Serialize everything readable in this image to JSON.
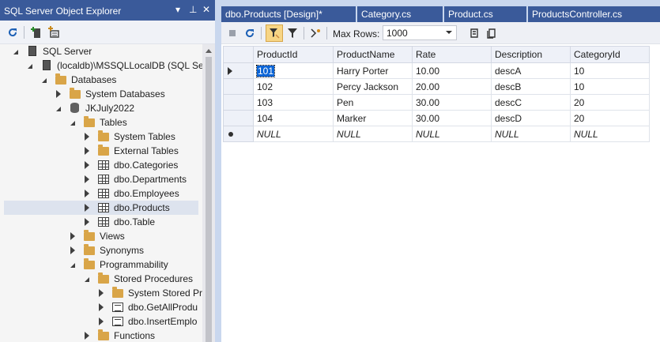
{
  "object_explorer": {
    "title": "SQL Server Object Explorer",
    "controls": {
      "dropdown": "▾",
      "pin": "⊥",
      "close": "✕"
    },
    "toolbar": {
      "refresh_icon": "refresh-icon",
      "add_server_icon": "add-server-icon",
      "filter_settings_icon": "filter-settings-icon"
    },
    "tree": [
      {
        "label": "SQL Server",
        "icon": "server-group-icon",
        "expanded": true
      },
      {
        "label": "(localdb)\\MSSQLLocalDB (SQL Se",
        "icon": "server-icon",
        "expanded": true
      },
      {
        "label": "Databases",
        "icon": "folder-icon",
        "expanded": true
      },
      {
        "label": "System Databases",
        "icon": "folder-icon",
        "expanded": false
      },
      {
        "label": "JKJuly2022",
        "icon": "database-icon",
        "expanded": true
      },
      {
        "label": "Tables",
        "icon": "folder-icon",
        "expanded": true
      },
      {
        "label": "System Tables",
        "icon": "folder-icon",
        "expanded": false
      },
      {
        "label": "External Tables",
        "icon": "folder-icon",
        "expanded": false
      },
      {
        "label": "dbo.Categories",
        "icon": "table-icon",
        "expanded": false
      },
      {
        "label": "dbo.Departments",
        "icon": "table-icon",
        "expanded": false
      },
      {
        "label": "dbo.Employees",
        "icon": "table-icon",
        "expanded": false
      },
      {
        "label": "dbo.Products",
        "icon": "table-icon",
        "expanded": false,
        "selected": true
      },
      {
        "label": "dbo.Table",
        "icon": "table-icon",
        "expanded": false
      },
      {
        "label": "Views",
        "icon": "folder-icon",
        "expanded": false
      },
      {
        "label": "Synonyms",
        "icon": "folder-icon",
        "expanded": false
      },
      {
        "label": "Programmability",
        "icon": "folder-icon",
        "expanded": true
      },
      {
        "label": "Stored Procedures",
        "icon": "folder-icon",
        "expanded": true
      },
      {
        "label": "System Stored Pr",
        "icon": "folder-icon",
        "expanded": false
      },
      {
        "label": "dbo.GetAllProdu",
        "icon": "stored-procedure-icon",
        "expanded": false
      },
      {
        "label": "dbo.InsertEmplo",
        "icon": "stored-procedure-icon",
        "expanded": false
      },
      {
        "label": "Functions",
        "icon": "folder-icon",
        "expanded": false
      }
    ]
  },
  "tabs": [
    {
      "label": "dbo.Products [Design]*",
      "active": true
    },
    {
      "label": "Category.cs",
      "active": false
    },
    {
      "label": "Product.cs",
      "active": false
    },
    {
      "label": "ProductsController.cs",
      "active": false
    }
  ],
  "data_toolbar": {
    "stop_icon": "stop-icon",
    "refresh_icon": "refresh-icon",
    "filter_sort_icon": "filter-sort-icon",
    "filter_icon": "filter-icon",
    "stop_on_error_icon": "stop-on-error-icon",
    "max_rows_label": "Max Rows:",
    "max_rows_value": "1000",
    "script_icon": "script-icon",
    "script_file_icon": "script-file-icon"
  },
  "grid": {
    "columns": [
      "ProductId",
      "ProductName",
      "Rate",
      "Description",
      "CategoryId"
    ],
    "rows": [
      [
        "101",
        "Harry Porter",
        "10.00",
        "descA",
        "10"
      ],
      [
        "102",
        "Percy Jackson",
        "20.00",
        "descB",
        "10"
      ],
      [
        "103",
        "Pen",
        "30.00",
        "descC",
        "20"
      ],
      [
        "104",
        "Marker",
        "30.00",
        "descD",
        "20"
      ]
    ],
    "new_row": [
      "NULL",
      "NULL",
      "NULL",
      "NULL",
      "NULL"
    ]
  },
  "colors": {
    "title_bar": "#3a5a9a",
    "selection": "#0a64d6",
    "folder": "#d9a548"
  }
}
